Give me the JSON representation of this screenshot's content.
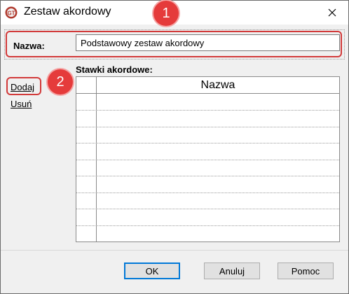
{
  "window": {
    "title": "Zestaw akordowy"
  },
  "name_field": {
    "label": "Nazwa:",
    "value": "Podstawowy zestaw akordowy"
  },
  "actions": {
    "add_label": "Dodaj",
    "delete_label": "Usuń"
  },
  "grid": {
    "label": "Stawki akordowe:",
    "columns": [
      "Nazwa"
    ],
    "rows": [
      [
        ""
      ],
      [
        ""
      ],
      [
        ""
      ],
      [
        ""
      ],
      [
        ""
      ],
      [
        ""
      ],
      [
        ""
      ],
      [
        ""
      ],
      [
        ""
      ]
    ]
  },
  "buttons": {
    "ok": "OK",
    "cancel": "Anuluj",
    "help": "Pomoc"
  },
  "annotations": {
    "badge1": "1",
    "badge2": "2"
  },
  "colors": {
    "highlight": "#d23a3a",
    "badge": "#e53b3b",
    "accent": "#0078d7"
  },
  "icons": {
    "app": "app-logo-icon",
    "close": "close-icon"
  }
}
